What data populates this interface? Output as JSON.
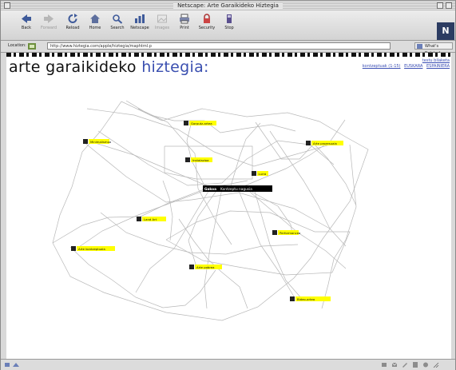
{
  "window": {
    "title": "Netscape: Arte Garaikideko Hiztegia"
  },
  "toolbar": {
    "buttons": [
      {
        "label": "Back",
        "icon": "back-arrow-icon",
        "enabled": true
      },
      {
        "label": "Forward",
        "icon": "forward-arrow-icon",
        "enabled": false
      },
      {
        "label": "Reload",
        "icon": "reload-icon",
        "enabled": true
      },
      {
        "label": "Home",
        "icon": "home-icon",
        "enabled": true
      },
      {
        "label": "Search",
        "icon": "search-icon",
        "enabled": true
      },
      {
        "label": "Netscape",
        "icon": "netscape-icon",
        "enabled": true
      },
      {
        "label": "Images",
        "icon": "images-icon",
        "enabled": false
      },
      {
        "label": "Print",
        "icon": "print-icon",
        "enabled": true
      },
      {
        "label": "Security",
        "icon": "security-lock-icon",
        "enabled": true
      },
      {
        "label": "Stop",
        "icon": "stop-icon",
        "enabled": true
      }
    ],
    "logo": "N"
  },
  "location": {
    "label": "Location:",
    "url": "http://www.hiztegia.com/apple/hiztegia/maphtml.p",
    "related_label": "What's Related"
  },
  "page": {
    "title_main": "arte garaikideko",
    "title_accent": "hiztegia:",
    "links_top": [
      "testu bilaketa"
    ],
    "links_bottom": [
      "kontzeptuak (1-15)",
      "EUSKARA",
      "ESPAINIERA"
    ]
  },
  "colors": {
    "title_accent": "#3a4fb0",
    "link": "#3b4fb4",
    "node_label_bg": "#ffff00",
    "center_label_bg": "#000000",
    "edge": "#b8b8b8"
  },
  "graph": {
    "center": {
      "code": "Gakoa",
      "label": "Kontzeptu nagusia"
    },
    "nodes": [
      {
        "label": "Gorputz-artea"
      },
      {
        "label": "Minimalismoa"
      },
      {
        "label": "Arte prozesuala"
      },
      {
        "label": "Instalazioa"
      },
      {
        "label": "Lurra"
      },
      {
        "label": "Land Art"
      },
      {
        "label": "Performancea"
      },
      {
        "label": "Arte kontzeptuala"
      },
      {
        "label": "Arte pobrea"
      },
      {
        "label": "Bideo-artea"
      }
    ]
  }
}
